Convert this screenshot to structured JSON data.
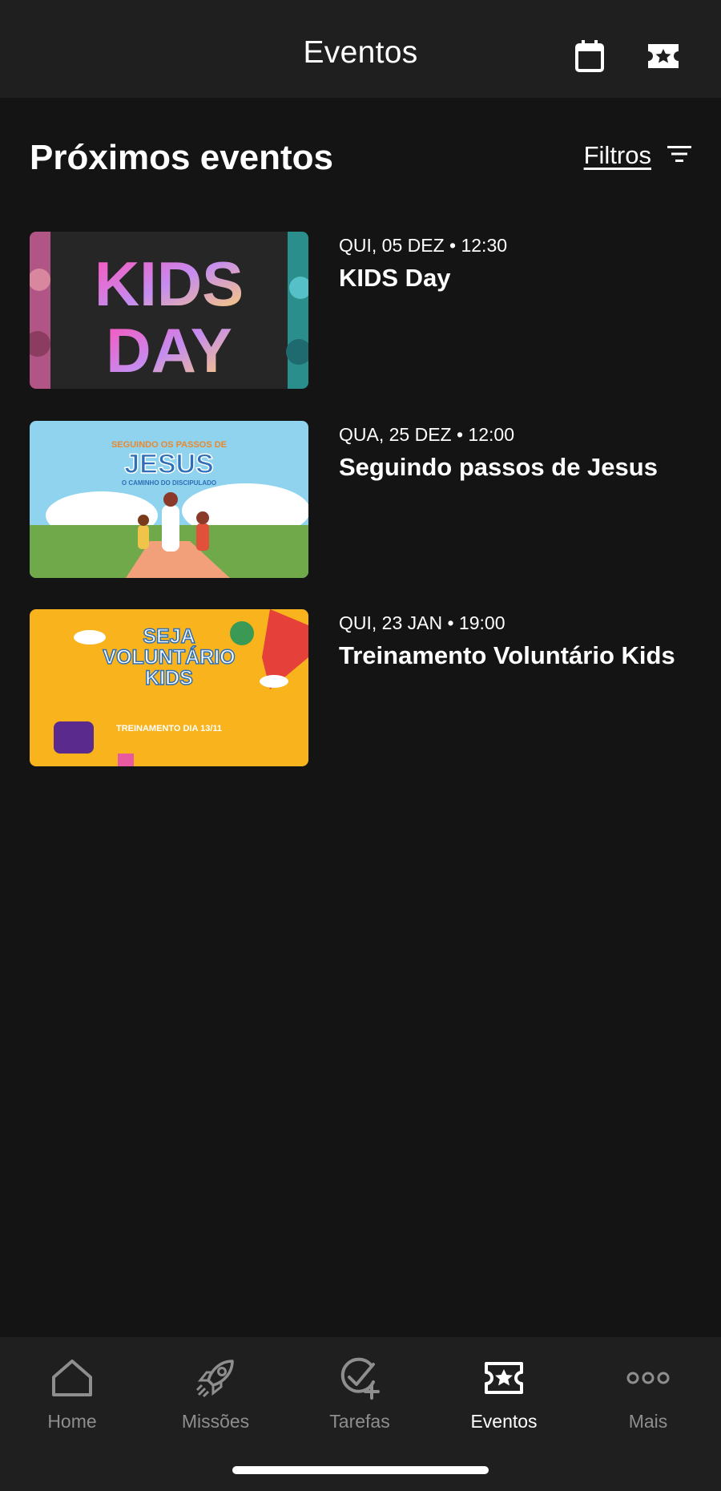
{
  "header": {
    "title": "Eventos"
  },
  "section": {
    "title": "Próximos eventos",
    "filters_label": "Filtros"
  },
  "events": [
    {
      "date": "QUI, 05 DEZ • 12:30",
      "name": "KIDS Day",
      "thumb": {
        "l1": "KIDS",
        "l2": "DAY"
      }
    },
    {
      "date": "QUA, 25 DEZ • 12:00",
      "name": "Seguindo passos de Jesus",
      "thumb": {
        "l1": "SEGUINDO OS PASSOS DE",
        "l2": "JESUS",
        "l3": "O CAMINHO DO DISCIPULADO"
      }
    },
    {
      "date": "QUI, 23 JAN • 19:00",
      "name": "Treinamento Voluntário Kids",
      "thumb": {
        "l1": "SEJA",
        "l2": "VOLUNTÁRIO",
        "l3": "KIDS",
        "l4": "TREINAMENTO DIA 13/11"
      }
    }
  ],
  "tabs": [
    {
      "label": "Home",
      "icon": "home-icon",
      "active": false
    },
    {
      "label": "Missões",
      "icon": "rocket-icon",
      "active": false
    },
    {
      "label": "Tarefas",
      "icon": "task-add-icon",
      "active": false
    },
    {
      "label": "Eventos",
      "icon": "ticket-star-icon",
      "active": true
    },
    {
      "label": "Mais",
      "icon": "more-icon",
      "active": false
    }
  ],
  "colors": {
    "background": "#141414",
    "bar": "#1f1f1f",
    "inactive": "#8e8e8e",
    "active": "#ffffff"
  }
}
